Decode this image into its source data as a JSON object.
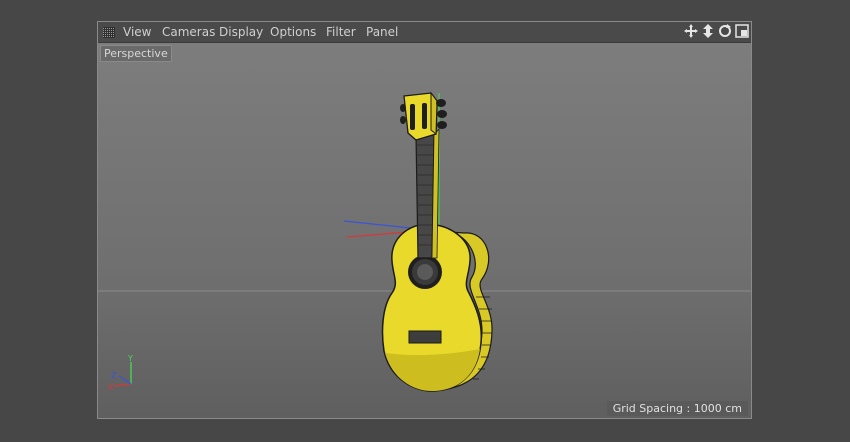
{
  "menu": {
    "items": [
      "View",
      "Cameras",
      "Display",
      "Options",
      "Filter",
      "Panel"
    ],
    "icons": [
      "move-icon",
      "dolly-icon",
      "rotate-icon",
      "maximize-icon"
    ]
  },
  "viewport": {
    "camera_label": "Perspective",
    "grid_info": "Grid Spacing : 1000 cm",
    "axis_labels": {
      "y": "Y",
      "x": "X",
      "z": "Z"
    }
  },
  "colors": {
    "guitar_yellow": "#e8d92a",
    "outline": "#1b1b1b",
    "neck_dark": "#474747",
    "axis_x": "#d33a3a",
    "axis_y": "#4ad65a",
    "axis_z": "#3b53d9"
  }
}
